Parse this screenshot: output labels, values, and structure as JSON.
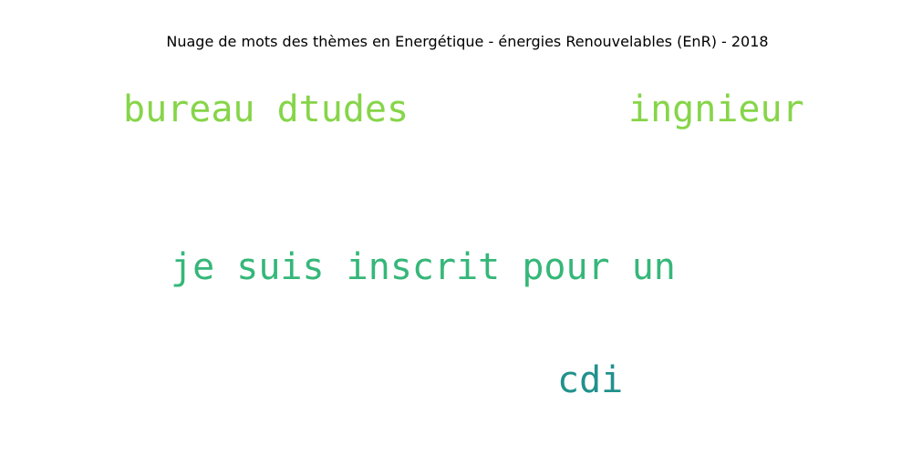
{
  "title": "Nuage de mots des thèmes en Energétique - énergies Renouvelables (EnR) - 2018",
  "words": [
    {
      "text": "bureau dtudes",
      "color": "#86d549"
    },
    {
      "text": "ingnieur",
      "color": "#86d549"
    },
    {
      "text": "je suis inscrit pour un",
      "color": "#35b779"
    },
    {
      "text": "cdi",
      "color": "#21918c"
    }
  ]
}
